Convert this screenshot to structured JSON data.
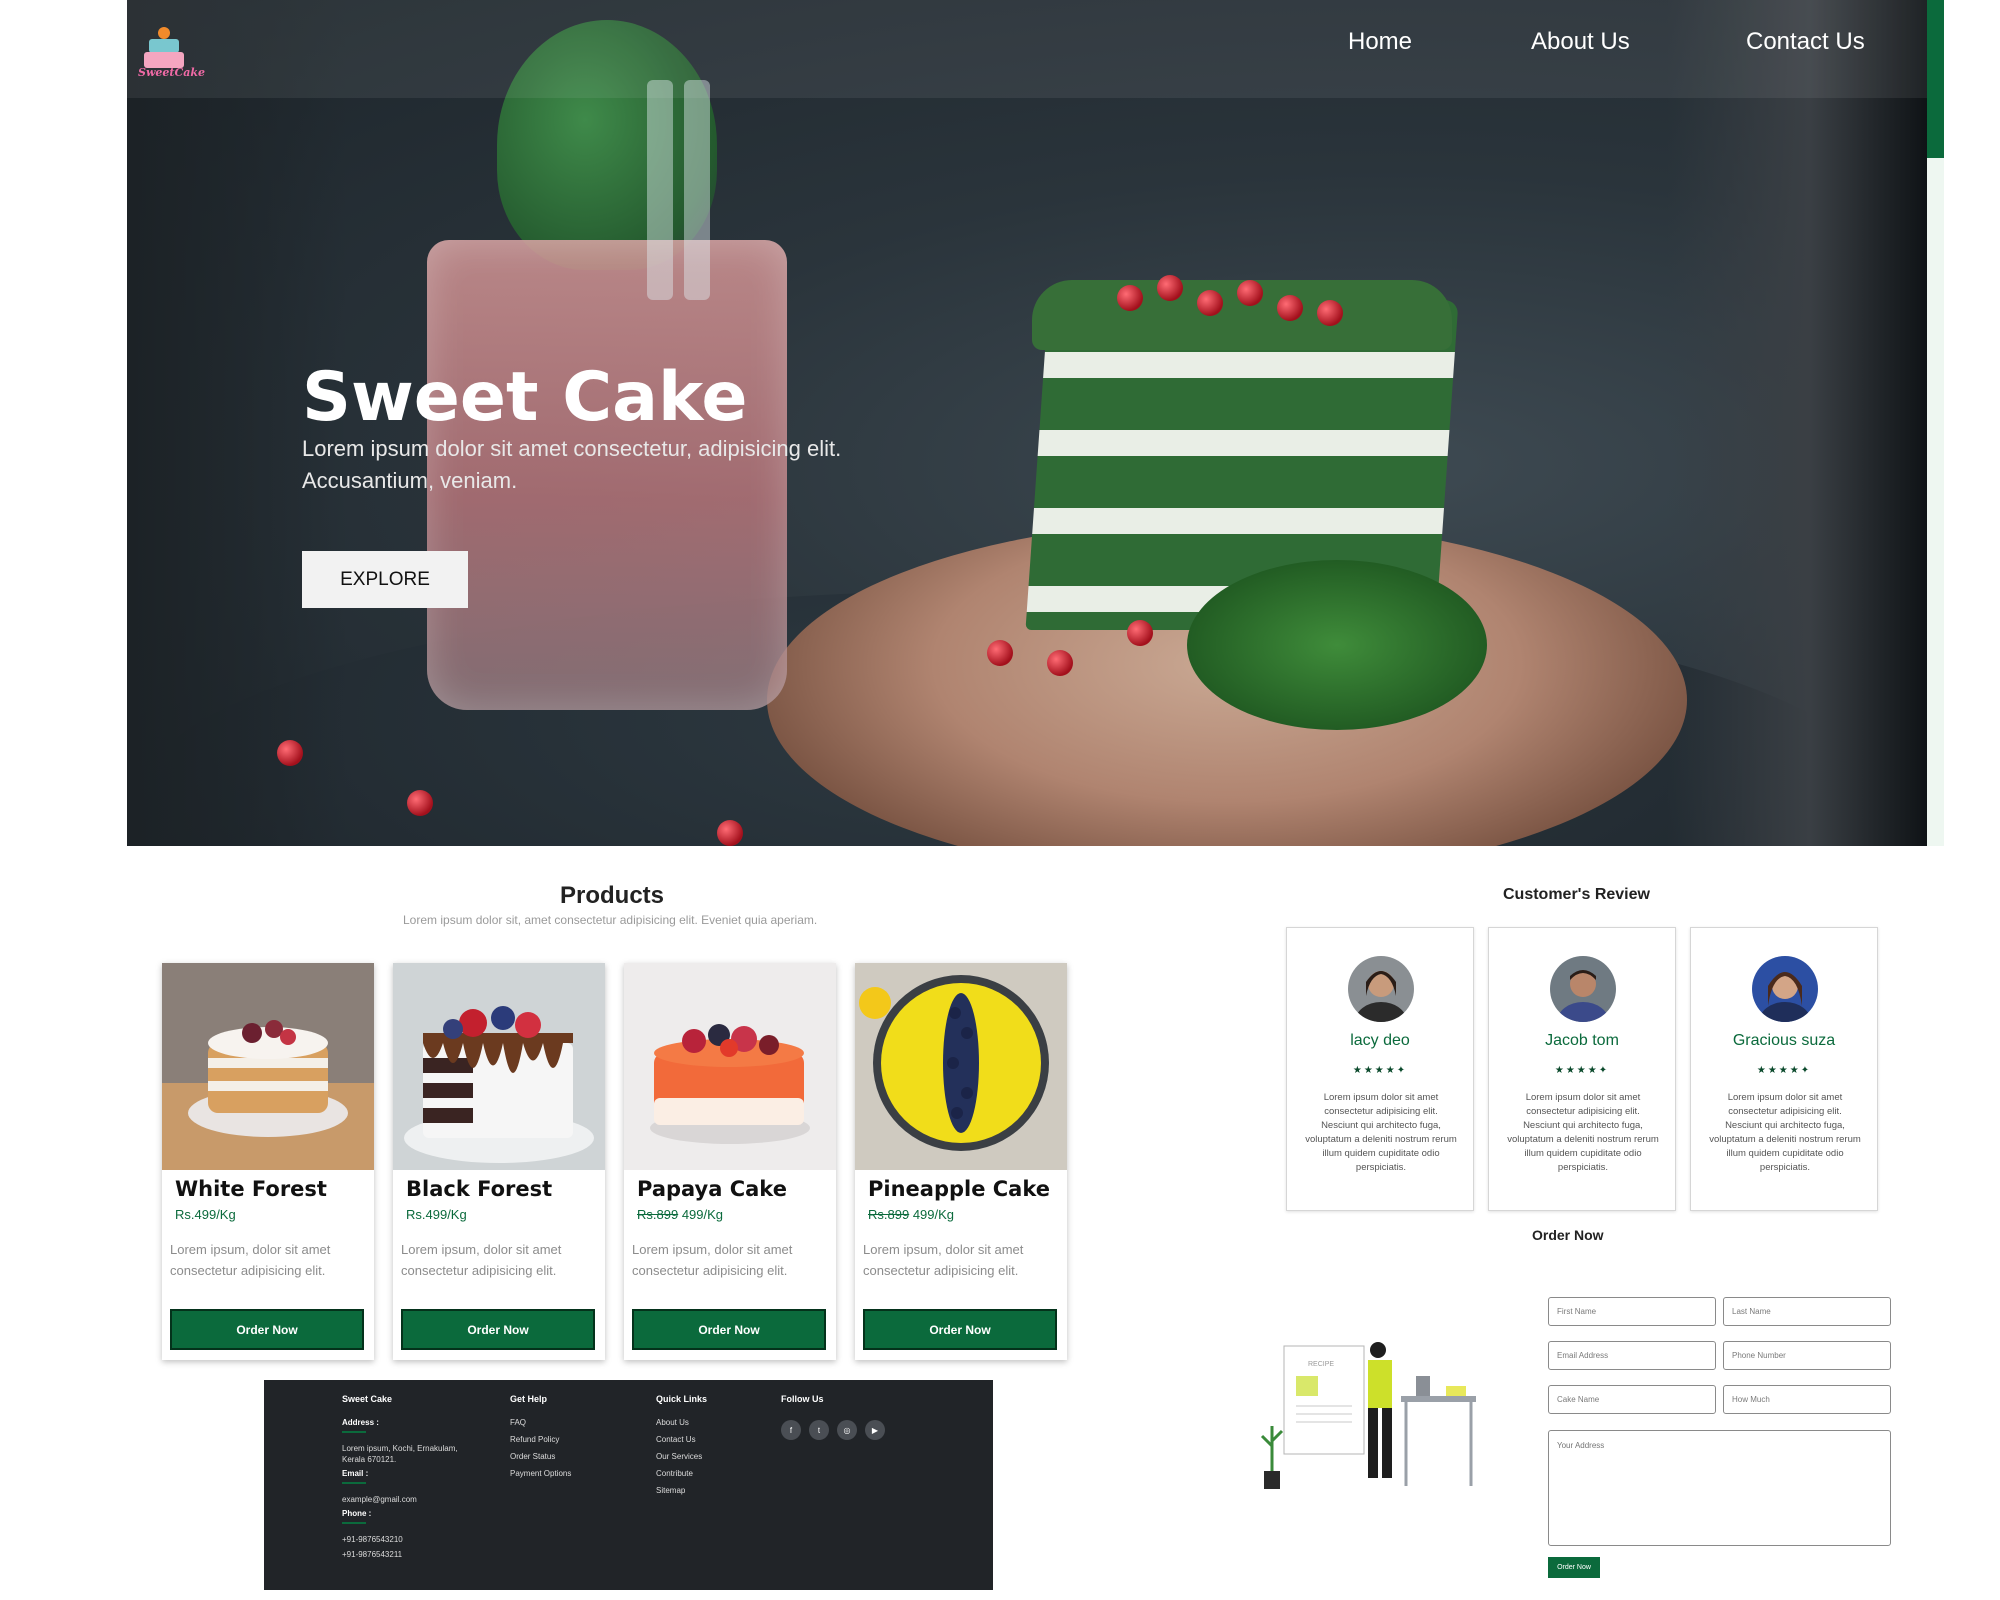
{
  "brand": {
    "logo_text": "SweetCake"
  },
  "nav": {
    "home": "Home",
    "about": "About Us",
    "contact": "Contact Us"
  },
  "hero": {
    "title": "Sweet Cake",
    "subtitle": "Lorem ipsum dolor sit amet consectetur, adipisicing elit. Accusantium, veniam.",
    "button": "EXPLORE"
  },
  "products": {
    "title": "Products",
    "subtitle": "Lorem ipsum dolor sit, amet consectetur adipisicing elit. Eveniet quia aperiam.",
    "items": [
      {
        "name": "White Forest",
        "old_price": "",
        "price": "Rs.499/Kg",
        "desc": "Lorem ipsum, dolor sit amet consectetur adipisicing elit.",
        "button": "Order Now"
      },
      {
        "name": "Black Forest",
        "old_price": "",
        "price": "Rs.499/Kg",
        "desc": "Lorem ipsum, dolor sit amet consectetur adipisicing elit.",
        "button": "Order Now"
      },
      {
        "name": "Papaya Cake",
        "old_price": "Rs.899",
        "price": "499/Kg",
        "desc": "Lorem ipsum, dolor sit amet consectetur adipisicing elit.",
        "button": "Order Now"
      },
      {
        "name": "Pineapple Cake",
        "old_price": "Rs.899",
        "price": "499/Kg",
        "desc": "Lorem ipsum, dolor sit amet consectetur adipisicing elit.",
        "button": "Order Now"
      }
    ]
  },
  "footer": {
    "brand": "Sweet Cake",
    "address_label": "Address :",
    "address": "Lorem ipsum, Kochi, Ernakulam, Kerala 670121.",
    "email_label": "Email :",
    "email": "example@gmail.com",
    "phone_label": "Phone :",
    "phone1": "+91-9876543210",
    "phone2": "+91-9876543211",
    "help_title": "Get Help",
    "help_links": [
      "FAQ",
      "Refund Policy",
      "Order Status",
      "Payment Options"
    ],
    "quick_title": "Quick Links",
    "quick_links": [
      "About Us",
      "Contact Us",
      "Our Services",
      "Contribute",
      "Sitemap"
    ],
    "follow_title": "Follow Us",
    "social_icons": [
      "facebook-icon",
      "twitter-icon",
      "instagram-icon",
      "youtube-icon"
    ]
  },
  "reviews": {
    "title": "Customer's Review",
    "items": [
      {
        "name": "lacy deo",
        "rating": 4.5,
        "stars": "★★★★✦",
        "text": "Lorem ipsum dolor sit amet consectetur adipisicing elit. Nesciunt qui architecto fuga, voluptatum a deleniti nostrum rerum illum quidem cupiditate odio perspiciatis."
      },
      {
        "name": "Jacob tom",
        "rating": 4.5,
        "stars": "★★★★✦",
        "text": "Lorem ipsum dolor sit amet consectetur adipisicing elit. Nesciunt qui architecto fuga, voluptatum a deleniti nostrum rerum illum quidem cupiditate odio perspiciatis."
      },
      {
        "name": "Gracious suza",
        "rating": 4.5,
        "stars": "★★★★✦",
        "text": "Lorem ipsum dolor sit amet consectetur adipisicing elit. Nesciunt qui architecto fuga, voluptatum a deleniti nostrum rerum illum quidem cupiditate odio perspiciatis."
      }
    ]
  },
  "order_form": {
    "title": "Order Now",
    "illustration_label": "RECIPE",
    "first_name": "First Name",
    "last_name": "Last Name",
    "email": "Email Address",
    "phone": "Phone Number",
    "cake_name": "Cake Name",
    "how_much": "How Much",
    "address": "Your Address",
    "submit": "Order Now"
  },
  "colors": {
    "accent": "#0b6a3c",
    "footer_bg": "#212428",
    "text_dark": "#222222"
  }
}
